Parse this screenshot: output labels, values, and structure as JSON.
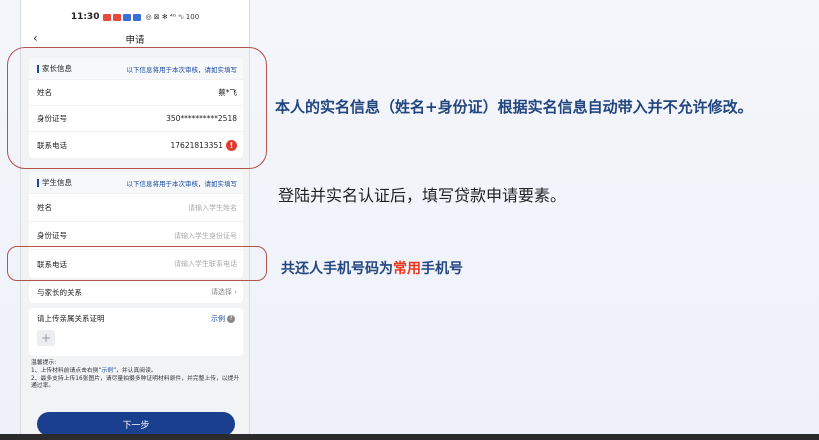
{
  "statusbar": {
    "time": "11:30",
    "right": "◎ ⊠ ✻ ⁴ᴳ ᵃᵢₗ 100"
  },
  "navbar": {
    "back_icon": "‹",
    "title": "申请"
  },
  "parent_section": {
    "title": "家长信息",
    "hint": "以下信息将用于本次审核，请如实填写",
    "rows": [
      {
        "label": "姓名",
        "value": "蔡*飞"
      },
      {
        "label": "身份证号",
        "value": "350**********2518"
      },
      {
        "label": "联系电话",
        "value": "17621813351"
      }
    ]
  },
  "student_section": {
    "title": "学生信息",
    "hint": "以下信息将用于本次审核，请如实填写",
    "rows": [
      {
        "label": "姓名",
        "placeholder": "请输入学生姓名"
      },
      {
        "label": "身份证号",
        "placeholder": "请输入学生身份证号"
      },
      {
        "label": "联系电话",
        "placeholder": "请输入学生联系电话"
      }
    ]
  },
  "relation": {
    "label": "与家长的关系",
    "select": "请选择 ›"
  },
  "upload": {
    "label": "请上传亲属关系证明",
    "example": "示例",
    "plus": "+"
  },
  "tips": {
    "title": "温馨提示:",
    "line1_a": "1、上传材料前请点击右侧“",
    "line1_hl": "示例",
    "line1_b": "”，并认真阅读。",
    "line2": "2、最多支持上传16张图片，请尽量拍摄多种证明材料原件，并完整上传，以提升通过率。"
  },
  "next_button": "下一步",
  "annotations": {
    "note1": "本人的实名信息（姓名+身份证）根据实名信息自动带入并不允许修改。",
    "note2": "登陆并实名认证后，填写贷款申请要素。",
    "note3_a": "共还人手机号码为",
    "note3_red": "常用",
    "note3_b": "手机号"
  },
  "colors": {
    "accent": "#1b3f8f",
    "highlight_border": "#b2544c",
    "red": "#e8391f"
  }
}
